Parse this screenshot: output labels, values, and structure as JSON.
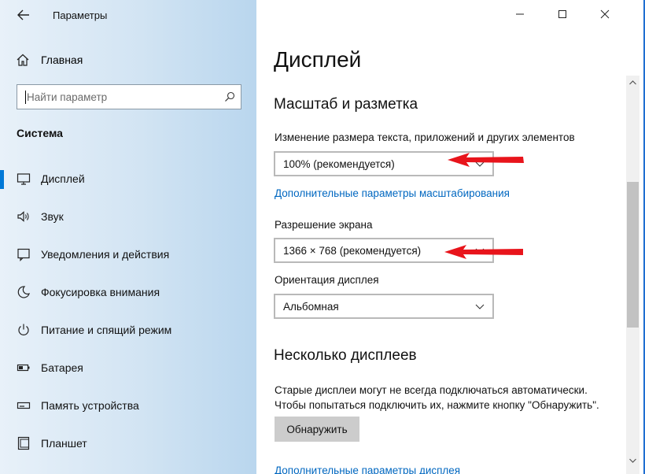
{
  "window": {
    "title": "Параметры"
  },
  "sidebar": {
    "home_label": "Главная",
    "search_placeholder": "Найти параметр",
    "section_title": "Система",
    "items": [
      {
        "label": "Дисплей",
        "icon": "monitor-icon",
        "active": true
      },
      {
        "label": "Звук",
        "icon": "speaker-icon"
      },
      {
        "label": "Уведомления и действия",
        "icon": "notification-icon"
      },
      {
        "label": "Фокусировка внимания",
        "icon": "moon-icon"
      },
      {
        "label": "Питание и спящий режим",
        "icon": "power-icon"
      },
      {
        "label": "Батарея",
        "icon": "battery-icon"
      },
      {
        "label": "Память устройства",
        "icon": "storage-icon"
      },
      {
        "label": "Планшет",
        "icon": "tablet-icon"
      }
    ]
  },
  "main": {
    "page_title": "Дисплей",
    "scale_section": {
      "title": "Масштаб и разметка",
      "scale_label": "Изменение размера текста, приложений и других элементов",
      "scale_value": "100% (рекомендуется)",
      "advanced_link": "Дополнительные параметры масштабирования",
      "resolution_label": "Разрешение экрана",
      "resolution_value": "1366 × 768 (рекомендуется)",
      "orientation_label": "Ориентация дисплея",
      "orientation_value": "Альбомная"
    },
    "multi_section": {
      "title": "Несколько дисплеев",
      "description_line1": "Старые дисплеи могут не всегда подключаться автоматически.",
      "description_line2": "Чтобы попытаться подключить их, нажмите кнопку \"Обнаружить\".",
      "detect_button": "Обнаружить",
      "cut_link": "Дополнительные параметры дисплея"
    }
  },
  "colors": {
    "accent": "#0078d7",
    "link": "#0067c0",
    "annotation_arrow": "#e8141b",
    "desktop_border": "#1f6fd1"
  }
}
